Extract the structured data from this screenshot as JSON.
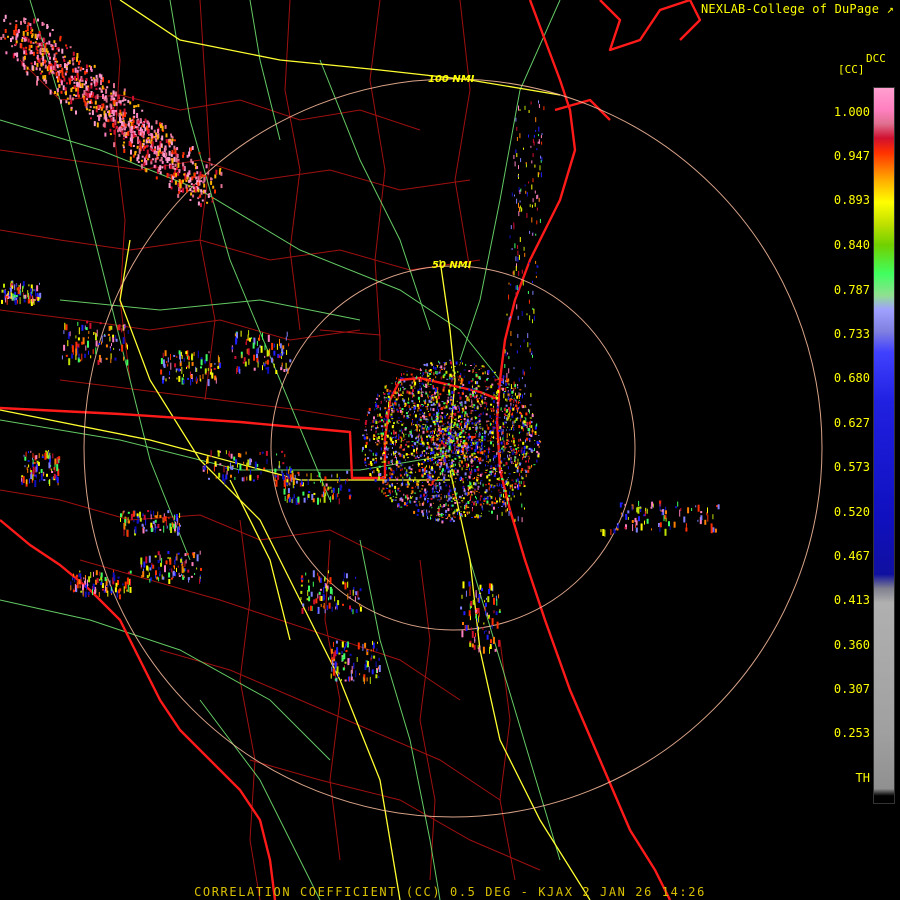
{
  "credit": "NEXLAB-College of DuPage",
  "credit_icon": "external-link-icon",
  "legend": {
    "product": "DCC",
    "unit": "[CC]",
    "ticks": [
      "1.000",
      "0.947",
      "0.893",
      "0.840",
      "0.787",
      "0.733",
      "0.680",
      "0.627",
      "0.573",
      "0.520",
      "0.467",
      "0.413",
      "0.360",
      "0.307",
      "0.253",
      "TH"
    ]
  },
  "rings": [
    "50 NMI",
    "100 NMI"
  ],
  "footer": "CORRELATION COEFFICIENT (CC) 0.5 DEG - KJAX 2 JAN 26 14:26",
  "colors": {
    "background": "#000000",
    "state_border": "#ff2020",
    "county_border": "#a01010",
    "highway": "#ffff40",
    "road": "#80ff80",
    "range_ring": "#ffc0a0",
    "text": "#ffff00"
  }
}
